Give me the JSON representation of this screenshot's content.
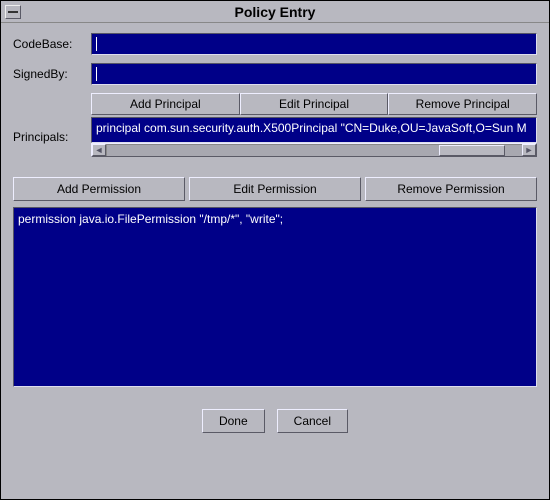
{
  "window": {
    "title": "Policy Entry"
  },
  "labels": {
    "codebase": "CodeBase:",
    "signedby": "SignedBy:",
    "principals": "Principals:"
  },
  "inputs": {
    "codebase": "",
    "signedby": ""
  },
  "principalButtons": {
    "add": "Add Principal",
    "edit": "Edit Principal",
    "remove": "Remove Principal"
  },
  "principalsList": [
    "principal com.sun.security.auth.X500Principal \"CN=Duke,OU=JavaSoft,O=Sun M"
  ],
  "permissionButtons": {
    "add": "Add Permission",
    "edit": "Edit Permission",
    "remove": "Remove Permission"
  },
  "permissionsList": [
    "permission java.io.FilePermission \"/tmp/*\", \"write\";"
  ],
  "bottomButtons": {
    "done": "Done",
    "cancel": "Cancel"
  },
  "scrollbar": {
    "thumbLeftPct": 80,
    "thumbWidthPct": 16
  }
}
